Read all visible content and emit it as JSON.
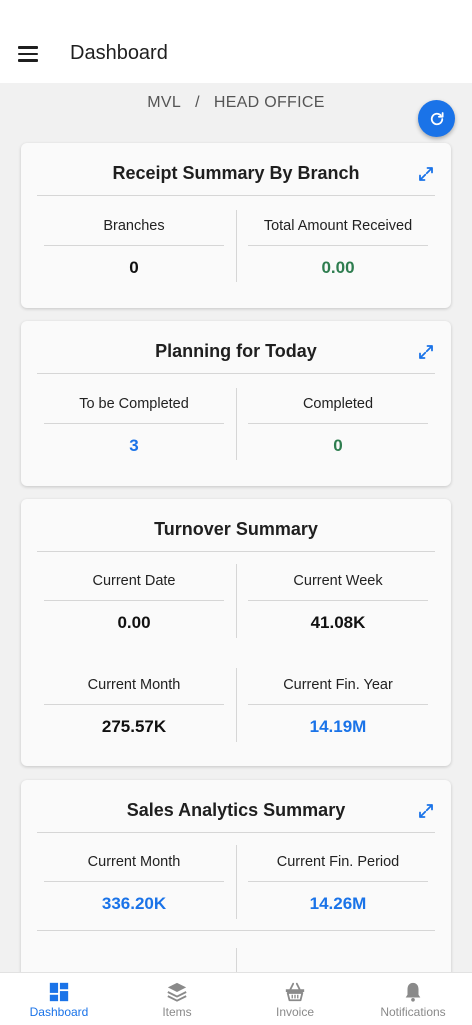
{
  "appbar": {
    "title": "Dashboard"
  },
  "breadcrumb": {
    "company": "MVL",
    "separator": "/",
    "branch": "HEAD OFFICE"
  },
  "colors": {
    "accent": "#1a73e8",
    "positive": "#2e7d4f",
    "neutral": "#111111"
  },
  "receipt_summary": {
    "title": "Receipt Summary By Branch",
    "branches_label": "Branches",
    "branches_value": "0",
    "total_label": "Total Amount Received",
    "total_value": "0.00"
  },
  "planning": {
    "title": "Planning for Today",
    "to_complete_label": "To be Completed",
    "to_complete_value": "3",
    "completed_label": "Completed",
    "completed_value": "0"
  },
  "turnover": {
    "title": "Turnover Summary",
    "current_date_label": "Current Date",
    "current_date_value": "0.00",
    "current_week_label": "Current Week",
    "current_week_value": "41.08K",
    "current_month_label": "Current Month",
    "current_month_value": "275.57K",
    "current_fin_year_label": "Current Fin. Year",
    "current_fin_year_value": "14.19M"
  },
  "sales_analytics": {
    "title": "Sales Analytics Summary",
    "current_month_label": "Current Month",
    "current_month_value": "336.20K",
    "current_fin_period_label": "Current Fin. Period",
    "current_fin_period_value": "14.26M"
  },
  "bottom_nav": {
    "items": [
      {
        "label": "Dashboard",
        "icon": "dashboard-icon",
        "active": true
      },
      {
        "label": "Items",
        "icon": "layers-icon",
        "active": false
      },
      {
        "label": "Invoice",
        "icon": "basket-icon",
        "active": false
      },
      {
        "label": "Notifications",
        "icon": "bell-icon",
        "active": false
      }
    ]
  }
}
